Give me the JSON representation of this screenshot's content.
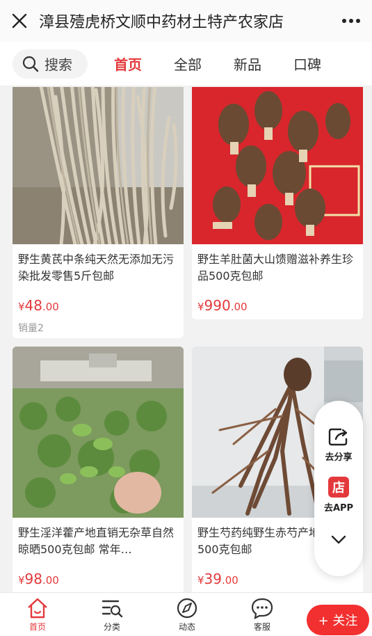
{
  "header": {
    "title": "漳县殪虎桥文顺中药材土特产农家店",
    "close_icon": "close-icon",
    "more_icon": "more-icon"
  },
  "nav": {
    "search_label": "搜索",
    "tabs": [
      {
        "label": "首页",
        "active": true
      },
      {
        "label": "全部",
        "active": false
      },
      {
        "label": "新品",
        "active": false
      },
      {
        "label": "口碑",
        "active": false
      }
    ]
  },
  "products": [
    {
      "name": "野生黄芪中条纯天然无添加无污染批发零售5斤包邮",
      "price_symbol": "¥",
      "price_int": "48",
      "price_dec": ".00",
      "sales": "销量2"
    },
    {
      "name": "野生羊肚菌大山馈赠滋补养生珍品500克包邮",
      "price_symbol": "¥",
      "price_int": "990",
      "price_dec": ".00",
      "sales": ""
    },
    {
      "name": "野生淫洋藿产地直销无杂草自然晾晒500克包邮 常年…",
      "price_symbol": "¥",
      "price_int": "98",
      "price_dec": ".00",
      "sales": ""
    },
    {
      "name": "野生芍药纯野生赤芍产地直销500克包邮",
      "price_symbol": "¥",
      "price_int": "39",
      "price_dec": ".00",
      "sales": ""
    }
  ],
  "float_panel": {
    "share_label": "去分享",
    "app_badge": "店",
    "app_label": "去APP"
  },
  "bottom_bar": {
    "items": [
      {
        "label": "首页",
        "icon": "home-icon"
      },
      {
        "label": "分类",
        "icon": "category-icon"
      },
      {
        "label": "动态",
        "icon": "compass-icon"
      },
      {
        "label": "客服",
        "icon": "chat-icon"
      }
    ],
    "follow_label": "+ 关注"
  },
  "colors": {
    "accent": "#e4393c",
    "follow_button": "#f23030"
  }
}
